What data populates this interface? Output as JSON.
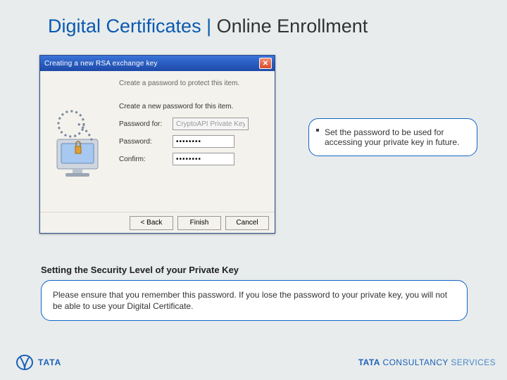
{
  "title": {
    "blue": "Digital Certificates",
    "pipe": "|",
    "rest": "Online Enrollment"
  },
  "dialog": {
    "titlebar": "Creating a new RSA exchange key",
    "intro": "Create a password to protect this item.",
    "subintro": "Create a new password for this item.",
    "labels": {
      "for": "Password for:",
      "pw": "Password:",
      "confirm": "Confirm:"
    },
    "fields": {
      "for": "CryptoAPI Private Key",
      "pw": "••••••••",
      "confirm": "••••••••"
    },
    "buttons": {
      "back": "< Back",
      "finish": "Finish",
      "cancel": "Cancel"
    }
  },
  "callout1": "Set the password to be used for accessing your private key in future.",
  "subhead": "Setting the Security Level of your Private Key",
  "callout2": "Please ensure that you remember this password. If you lose the password to your private key, you will not be able to use your Digital Certificate.",
  "footer": {
    "tata": "TATA",
    "tcs_bold": "TATA",
    "tcs_mid": " CONSULTANCY ",
    "tcs_light": "SERVICES"
  }
}
